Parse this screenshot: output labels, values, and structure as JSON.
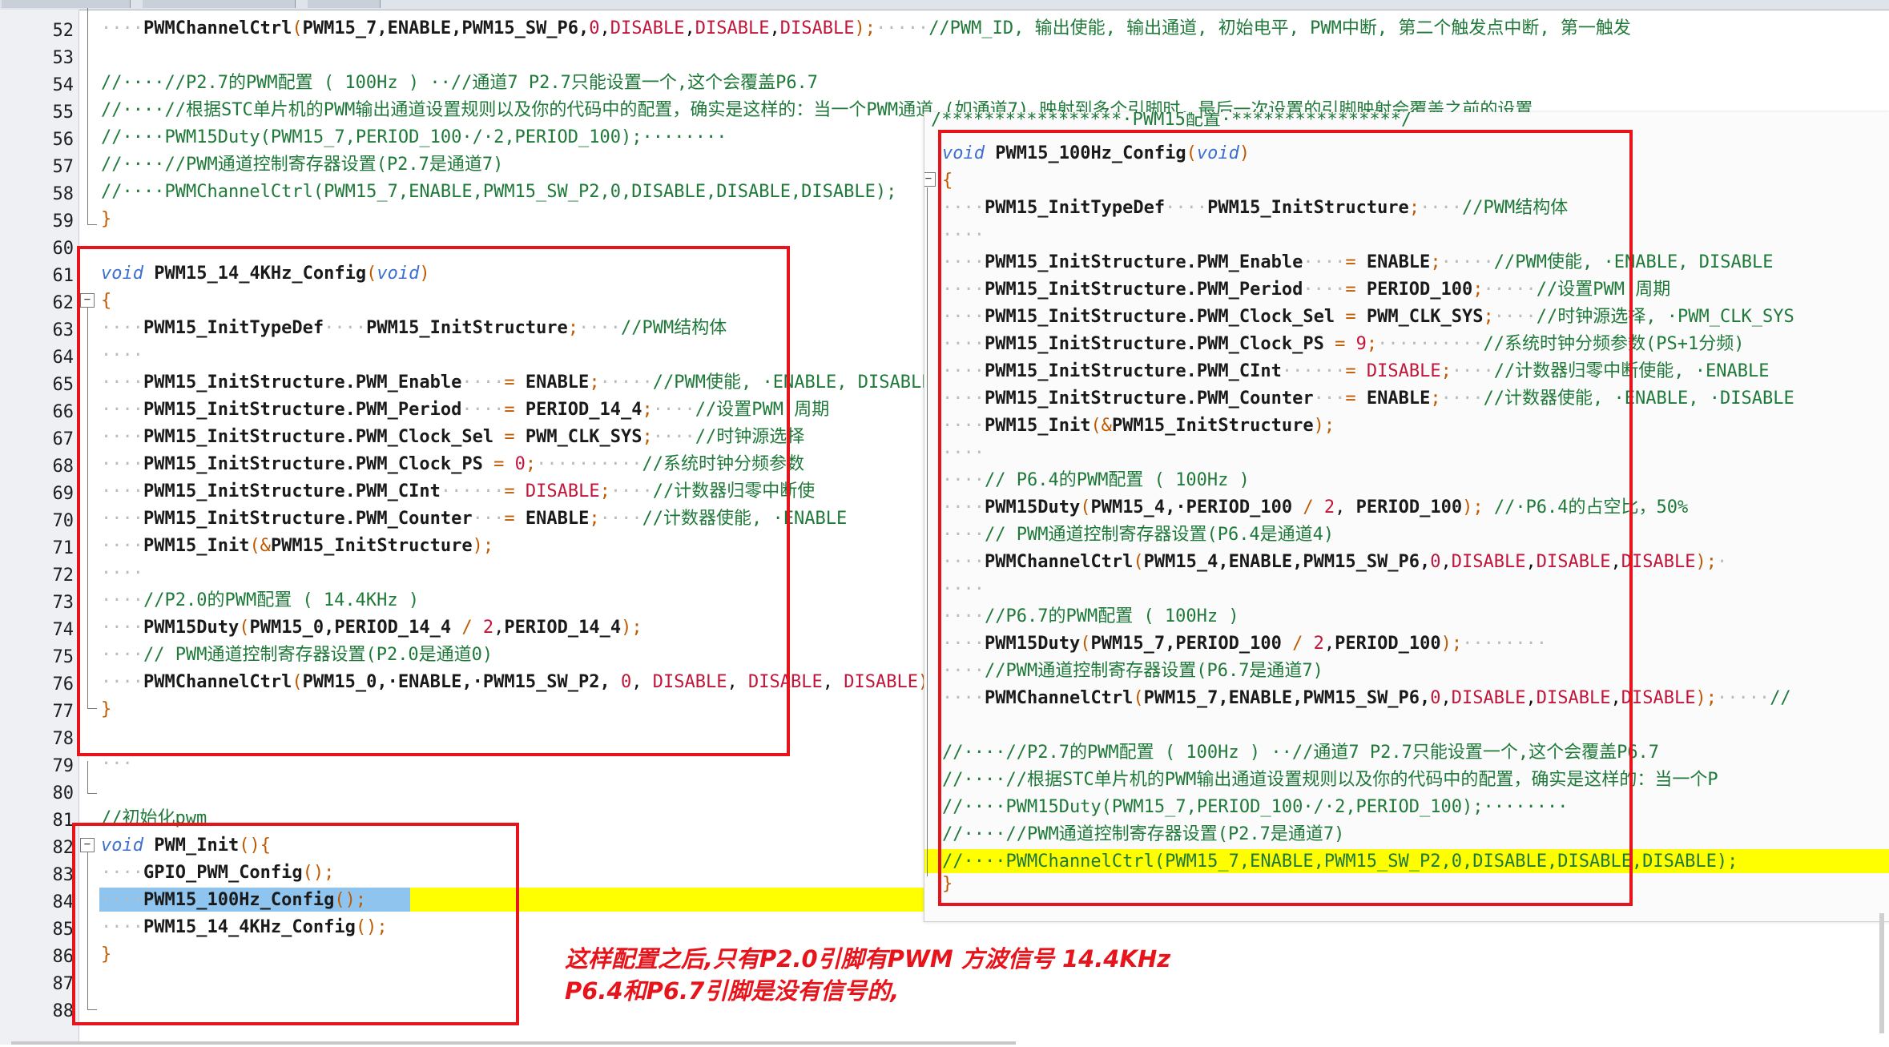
{
  "main_lines": [
    {
      "n": "52",
      "html": "<span class=\"dot\">····</span><span class=\"fn\">PWMChannelCtrl</span><span class=\"op\">(</span><span class=\"fn\">PWM15_7</span><span class=\"fn\">,ENABLE,PWM15_SW_P6,</span><span class=\"num\">0</span>,<span class=\"dis\">DISABLE</span>,<span class=\"dis\">DISABLE</span>,<span class=\"dis\">DISABLE</span><span class=\"op\">);</span><span class=\"dot\">·····</span><span class=\"cm\">//PWM_ID, 输出使能, 输出通道, 初始电平, PWM中断, 第二个触发点中断, 第一触发</span>"
    },
    {
      "n": "53",
      "html": ""
    },
    {
      "n": "54",
      "html": "<span class=\"cm\">//····//P2.7的PWM配置 ( 100Hz ) ··//通道7 P2.7只能设置一个,这个会覆盖P6.7</span>"
    },
    {
      "n": "55",
      "html": "<span class=\"cm\">//····//根据STC单片机的PWM输出通道设置规则以及你的代码中的配置，确实是这样的：当一个PWM通道 (如通道7) 映射到多个引脚时，最后一次设置的引脚映射会覆盖之前的设置</span>"
    },
    {
      "n": "56",
      "html": "<span class=\"cm\">//····PWM15Duty(PWM15_7,PERIOD_100·/·2,PERIOD_100);········</span>"
    },
    {
      "n": "57",
      "html": "<span class=\"cm\">//····//PWM通道控制寄存器设置(P2.7是通道7)</span>"
    },
    {
      "n": "58",
      "html": "<span class=\"cm\">//····PWMChannelCtrl(PWM15_7,ENABLE,PWM15_SW_P2,0,DISABLE,DISABLE,DISABLE);</span>"
    },
    {
      "n": "59",
      "html": "<span class=\"op\">}</span>"
    },
    {
      "n": "60",
      "html": ""
    },
    {
      "n": "61",
      "html": "<span class=\"kw\">void</span> <span class=\"fn\">PWM15_14_4KHz_Config</span><span class=\"op\">(</span><span class=\"kw\">void</span><span class=\"op\">)</span>"
    },
    {
      "n": "62",
      "html": "<span class=\"op\">{</span>"
    },
    {
      "n": "63",
      "html": "<span class=\"dot\">····</span><span class=\"fn\">PWM15_InitTypeDef</span><span class=\"dot\">····</span><span class=\"fn\">PWM15_InitStructure</span><span class=\"op\">;</span><span class=\"dot\">····</span><span class=\"cm\">//PWM结构体</span>"
    },
    {
      "n": "64",
      "html": "<span class=\"dot\">····</span>"
    },
    {
      "n": "65",
      "html": "<span class=\"dot\">····</span><span class=\"fn\">PWM15_InitStructure.PWM_Enable</span><span class=\"dot\">····</span><span class=\"op\">=</span> <span class=\"fn\">ENABLE</span><span class=\"op\">;</span><span class=\"dot\">·····</span><span class=\"cm\">//PWM使能, ·ENABLE, DISABLE</span>"
    },
    {
      "n": "66",
      "html": "<span class=\"dot\">····</span><span class=\"fn\">PWM15_InitStructure.PWM_Period</span><span class=\"dot\">····</span><span class=\"op\">=</span> <span class=\"fn\">PERIOD_14_4</span><span class=\"op\">;</span><span class=\"dot\">····</span><span class=\"cm\">//设置PWM 周期</span>"
    },
    {
      "n": "67",
      "html": "<span class=\"dot\">····</span><span class=\"fn\">PWM15_InitStructure.PWM_Clock_Sel</span> <span class=\"op\">=</span> <span class=\"fn\">PWM_CLK_SYS</span><span class=\"op\">;</span><span class=\"dot\">····</span><span class=\"cm\">//时钟源选择</span>"
    },
    {
      "n": "68",
      "html": "<span class=\"dot\">····</span><span class=\"fn\">PWM15_InitStructure.PWM_Clock_PS</span> <span class=\"op\">=</span> <span class=\"num\">0</span><span class=\"op\">;</span><span class=\"dot\">··········</span><span class=\"cm\">//系统时钟分频参数</span>"
    },
    {
      "n": "69",
      "html": "<span class=\"dot\">····</span><span class=\"fn\">PWM15_InitStructure.PWM_CInt</span><span class=\"dot\">······</span><span class=\"op\">=</span> <span class=\"dis\">DISABLE</span><span class=\"op\">;</span><span class=\"dot\">····</span><span class=\"cm\">//计数器归零中断使</span>"
    },
    {
      "n": "70",
      "html": "<span class=\"dot\">····</span><span class=\"fn\">PWM15_InitStructure.PWM_Counter</span><span class=\"dot\">···</span><span class=\"op\">=</span> <span class=\"fn\">ENABLE</span><span class=\"op\">;</span><span class=\"dot\">····</span><span class=\"cm\">//计数器使能, ·ENABLE</span>"
    },
    {
      "n": "71",
      "html": "<span class=\"dot\">····</span><span class=\"fn\">PWM15_Init</span><span class=\"op\">(&amp;</span><span class=\"fn\">PWM15_InitStructure</span><span class=\"op\">);</span>"
    },
    {
      "n": "72",
      "html": "<span class=\"dot\">····</span>"
    },
    {
      "n": "73",
      "html": "<span class=\"dot\">····</span><span class=\"cm\">//P2.0的PWM配置 ( 14.4KHz )</span>"
    },
    {
      "n": "74",
      "html": "<span class=\"dot\">····</span><span class=\"fn\">PWM15Duty</span><span class=\"op\">(</span><span class=\"fn\">PWM15_0,PERIOD_14_4</span> <span class=\"op\">/</span> <span class=\"num\">2</span>,<span class=\"fn\">PERIOD_14_4</span><span class=\"op\">);</span>"
    },
    {
      "n": "75",
      "html": "<span class=\"dot\">····</span><span class=\"cm\">// PWM通道控制寄存器设置(P2.0是通道0)</span>"
    },
    {
      "n": "76",
      "html": "<span class=\"dot\">····</span><span class=\"fn\">PWMChannelCtrl</span><span class=\"op\">(</span><span class=\"fn\">PWM15_0,·ENABLE,·PWM15_SW_P2,</span> <span class=\"num\">0</span>, <span class=\"dis\">DISABLE</span>, <span class=\"dis\">DISABLE</span>, <span class=\"dis\">DISABLE</span><span class=\"op\">);</span>"
    },
    {
      "n": "77",
      "html": "<span class=\"op\">}</span>"
    },
    {
      "n": "78",
      "html": ""
    },
    {
      "n": "79",
      "html": "<span class=\"dot\">···</span>"
    },
    {
      "n": "80",
      "html": ""
    },
    {
      "n": "81",
      "html": "<span class=\"cm\">//初始化pwm</span>"
    },
    {
      "n": "82",
      "html": "<span class=\"kw\">void</span> <span class=\"fn\">PWM_Init</span><span class=\"op\">(){</span>"
    },
    {
      "n": "83",
      "html": "<span class=\"dot\">····</span><span class=\"fn\">GPIO_PWM_Config</span><span class=\"op\">();</span>"
    },
    {
      "n": "84",
      "html": "<span class=\"dot\">····</span><span class=\"fn\">PWM15_100Hz_Config</span><span class=\"op\">();</span>"
    },
    {
      "n": "85",
      "html": "<span class=\"dot\">····</span><span class=\"fn\">PWM15_14_4KHz_Config</span><span class=\"op\">();</span>"
    },
    {
      "n": "86",
      "html": "<span class=\"op\">}</span>"
    },
    {
      "n": "87",
      "html": ""
    },
    {
      "n": "88",
      "html": ""
    }
  ],
  "popup_lines": [
    {
      "html": "<span class=\"cm\">/*****************·PWM15配置·****************/</span>"
    },
    {
      "html": "<span class=\"kw\">void</span> <span class=\"fn\">PWM15_100Hz_Config</span><span class=\"op\">(</span><span class=\"kw\">void</span><span class=\"op\">)</span>"
    },
    {
      "html": ""
    },
    {
      "html": "<span class=\"op\">{</span>"
    },
    {
      "html": "<span class=\"dot\">····</span><span class=\"fn\">PWM15_InitTypeDef</span><span class=\"dot\">····</span><span class=\"fn\">PWM15_InitStructure</span><span class=\"op\">;</span><span class=\"dot\">····</span><span class=\"cm\">//PWM结构体</span>"
    },
    {
      "html": "<span class=\"dot\">····</span>"
    },
    {
      "html": "<span class=\"dot\">····</span><span class=\"fn\">PWM15_InitStructure.PWM_Enable</span><span class=\"dot\">····</span><span class=\"op\">=</span> <span class=\"fn\">ENABLE</span><span class=\"op\">;</span><span class=\"dot\">·····</span><span class=\"cm\">//PWM使能, ·ENABLE, DISABLE</span>"
    },
    {
      "html": "<span class=\"dot\">····</span><span class=\"fn\">PWM15_InitStructure.PWM_Period</span><span class=\"dot\">····</span><span class=\"op\">=</span> <span class=\"fn\">PERIOD_100</span><span class=\"op\">;</span><span class=\"dot\">·····</span><span class=\"cm\">//设置PWM 周期</span>"
    },
    {
      "html": "<span class=\"dot\">····</span><span class=\"fn\">PWM15_InitStructure.PWM_Clock_Sel</span> <span class=\"op\">=</span> <span class=\"fn\">PWM_CLK_SYS</span><span class=\"op\">;</span><span class=\"dot\">····</span><span class=\"cm\">//时钟源选择, ·PWM_CLK_SYS</span>"
    },
    {
      "html": "<span class=\"dot\">····</span><span class=\"fn\">PWM15_InitStructure.PWM_Clock_PS</span> <span class=\"op\">=</span> <span class=\"num\">9</span><span class=\"op\">;</span><span class=\"dot\">··········</span><span class=\"cm\">//系统时钟分频参数(PS+1分频)</span>"
    },
    {
      "html": "<span class=\"dot\">····</span><span class=\"fn\">PWM15_InitStructure.PWM_CInt</span><span class=\"dot\">······</span><span class=\"op\">=</span> <span class=\"dis\">DISABLE</span><span class=\"op\">;</span><span class=\"dot\">····</span><span class=\"cm\">//计数器归零中断使能, ·ENABLE</span>"
    },
    {
      "html": "<span class=\"dot\">····</span><span class=\"fn\">PWM15_InitStructure.PWM_Counter</span><span class=\"dot\">···</span><span class=\"op\">=</span> <span class=\"fn\">ENABLE</span><span class=\"op\">;</span><span class=\"dot\">····</span><span class=\"cm\">//计数器使能, ·ENABLE, ·DISABLE</span>"
    },
    {
      "html": "<span class=\"dot\">····</span><span class=\"fn\">PWM15_Init</span><span class=\"op\">(&amp;</span><span class=\"fn\">PWM15_InitStructure</span><span class=\"op\">);</span>"
    },
    {
      "html": "<span class=\"dot\">····</span>"
    },
    {
      "html": "<span class=\"dot\">····</span><span class=\"cm\">// P6.4的PWM配置 ( 100Hz )</span>"
    },
    {
      "html": "<span class=\"dot\">····</span><span class=\"fn\">PWM15Duty</span><span class=\"op\">(</span><span class=\"fn\">PWM15_4,·PERIOD_100</span> <span class=\"op\">/</span> <span class=\"num\">2</span>, <span class=\"fn\">PERIOD_100</span><span class=\"op\">);</span> <span class=\"cm\">//·P6.4的占空比，50%</span>"
    },
    {
      "html": "<span class=\"dot\">····</span><span class=\"cm\">// PWM通道控制寄存器设置(P6.4是通道4)</span>"
    },
    {
      "html": "<span class=\"dot\">····</span><span class=\"fn\">PWMChannelCtrl</span><span class=\"op\">(</span><span class=\"fn\">PWM15_4,ENABLE,PWM15_SW_P6,</span><span class=\"num\">0</span>,<span class=\"dis\">DISABLE</span>,<span class=\"dis\">DISABLE</span>,<span class=\"dis\">DISABLE</span><span class=\"op\">);</span><span class=\"dot\">·</span>"
    },
    {
      "html": "<span class=\"dot\">····</span>"
    },
    {
      "html": "<span class=\"dot\">····</span><span class=\"cm\">//P6.7的PWM配置 ( 100Hz )</span>"
    },
    {
      "html": "<span class=\"dot\">····</span><span class=\"fn\">PWM15Duty</span><span class=\"op\">(</span><span class=\"fn\">PWM15_7,PERIOD_100</span> <span class=\"op\">/</span> <span class=\"num\">2</span>,<span class=\"fn\">PERIOD_100</span><span class=\"op\">);</span><span class=\"dot\">········</span>"
    },
    {
      "html": "<span class=\"dot\">····</span><span class=\"cm\">//PWM通道控制寄存器设置(P6.7是通道7)</span>"
    },
    {
      "html": "<span class=\"dot\">····</span><span class=\"fn\">PWMChannelCtrl</span><span class=\"op\">(</span><span class=\"fn\">PWM15_7,ENABLE,PWM15_SW_P6,</span><span class=\"num\">0</span>,<span class=\"dis\">DISABLE</span>,<span class=\"dis\">DISABLE</span>,<span class=\"dis\">DISABLE</span><span class=\"op\">);</span><span class=\"dot\">·····</span><span class=\"cm\">//</span>"
    },
    {
      "html": ""
    },
    {
      "html": "<span class=\"cm\">//····//P2.7的PWM配置 ( 100Hz ) ··//通道7 P2.7只能设置一个,这个会覆盖P6.7</span>"
    },
    {
      "html": "<span class=\"cm\">//····//根据STC单片机的PWM输出通道设置规则以及你的代码中的配置，确实是这样的：当一个P</span>"
    },
    {
      "html": "<span class=\"cm\">//····PWM15Duty(PWM15_7,PERIOD_100·/·2,PERIOD_100);········</span>"
    },
    {
      "html": "<span class=\"cm\">//····//PWM通道控制寄存器设置(P2.7是通道7)</span>"
    },
    {
      "html": "<span class=\"cm\">//····PWMChannelCtrl(PWM15_7,ENABLE,PWM15_SW_P2,0,DISABLE,DISABLE,DISABLE);</span>"
    },
    {
      "html": "<span class=\"op\">}</span>"
    }
  ],
  "annotation": {
    "line1": "这样配置之后,只有P2.0引脚有PWM 方波信号 14.4KHz",
    "line2": "P6.4和P6.7引脚是没有信号的,"
  },
  "colors": {
    "highlight": "#ffff00",
    "selection": "#8fc4ee",
    "annotation_red": "#e8141b",
    "comment_green": "#1f7a3a",
    "keyword_blue": "#3b6ed1",
    "constant_red": "#c0163b"
  }
}
